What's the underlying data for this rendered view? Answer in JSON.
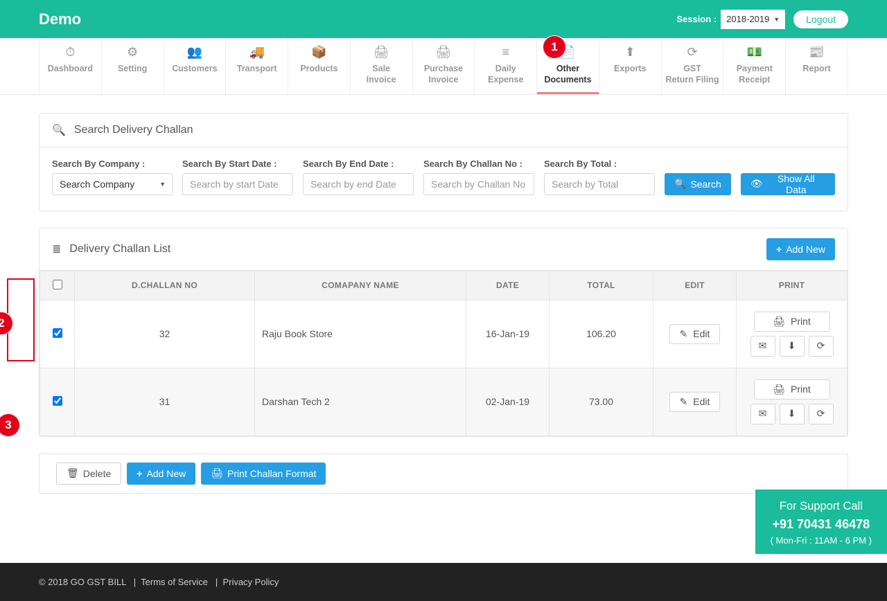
{
  "header": {
    "brand": "Demo",
    "session_label": "Session :",
    "session_value": "2018-2019",
    "logout": "Logout"
  },
  "nav": [
    {
      "label": "Dashboard",
      "icon": "⏱"
    },
    {
      "label": "Setting",
      "icon": "⚙"
    },
    {
      "label": "Customers",
      "icon": "👥"
    },
    {
      "label": "Transport",
      "icon": "🚚"
    },
    {
      "label": "Products",
      "icon": "📦"
    },
    {
      "label": "Sale Invoice",
      "icon": "🖨"
    },
    {
      "label": "Purchase Invoice",
      "icon": "🖨"
    },
    {
      "label": "Daily Expense",
      "icon": "≡"
    },
    {
      "label": "Other Documents",
      "icon": "📄",
      "active": true
    },
    {
      "label": "Exports",
      "icon": "⬆"
    },
    {
      "label": "GST Return Filing",
      "icon": "⟳"
    },
    {
      "label": "Payment Receipt",
      "icon": "💵"
    },
    {
      "label": "Report",
      "icon": "📰"
    }
  ],
  "search_panel": {
    "title": "Search Delivery Challan",
    "fields": {
      "company_label": "Search By Company :",
      "company_value": "Search Company",
      "start_label": "Search By Start Date :",
      "start_ph": "Search by start Date",
      "end_label": "Search By End Date :",
      "end_ph": "Search by end Date",
      "challan_label": "Search By Challan No :",
      "challan_ph": "Search by Challan No",
      "total_label": "Search By Total :",
      "total_ph": "Search by Total"
    },
    "search_btn": "Search",
    "showall_btn": "Show All Data"
  },
  "list_panel": {
    "title": "Delivery Challan List",
    "add_btn": "Add New",
    "columns": {
      "challan": "D.Challan No",
      "company": "Comapany Name",
      "date": "Date",
      "total": "Total",
      "edit": "Edit",
      "print": "Print"
    },
    "rows": [
      {
        "checked": true,
        "challan": "32",
        "company": "Raju Book Store",
        "date": "16-Jan-19",
        "total": "106.20"
      },
      {
        "checked": true,
        "challan": "31",
        "company": "Darshan Tech 2",
        "date": "02-Jan-19",
        "total": "73.00"
      }
    ],
    "edit_btn": "Edit",
    "print_btn": "Print"
  },
  "bottom_actions": {
    "delete": "Delete",
    "add": "Add New",
    "format": "Print Challan Format"
  },
  "footer": {
    "copy": "© 2018 GO GST BILL",
    "tos": "Terms of Service",
    "privacy": "Privacy Policy",
    "sep": "|"
  },
  "support": {
    "l1": "For Support Call",
    "l2": "+91 70431 46478",
    "l3": "( Mon-Fri : 11AM - 6 PM )"
  },
  "callouts": {
    "c1": "1",
    "c2": "2",
    "c3": "3"
  }
}
